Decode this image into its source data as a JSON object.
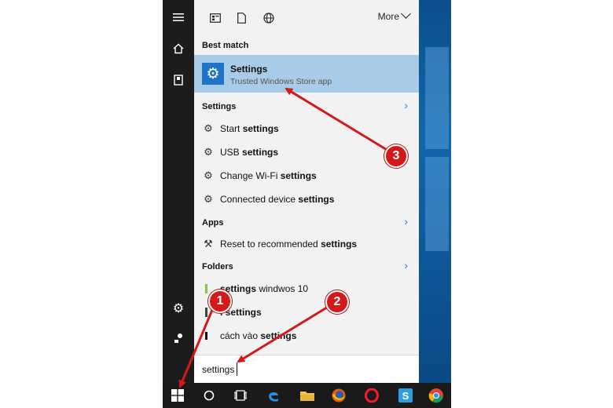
{
  "filters": {
    "more_label": "More"
  },
  "best_match": {
    "header": "Best match",
    "title": "Settings",
    "subtitle": "Trusted Windows Store app"
  },
  "settings_section": {
    "header": "Settings",
    "items": [
      {
        "plain": "Start ",
        "bold": "settings"
      },
      {
        "plain": "USB ",
        "bold": "settings"
      },
      {
        "plain": "Change Wi-Fi ",
        "bold": "settings"
      },
      {
        "plain": "Connected device ",
        "bold": "settings"
      }
    ]
  },
  "apps_section": {
    "header": "Apps",
    "items": [
      {
        "plain": "Reset to recommended ",
        "bold": "settings"
      }
    ]
  },
  "folders_section": {
    "header": "Folders",
    "items": [
      {
        "plain": "",
        "bold": "settings",
        "rest": " windwos 10"
      },
      {
        "plain": "",
        "bold": "i settings",
        "rest": ""
      },
      {
        "plain": "cách vào ",
        "bold": "settings",
        "rest": ""
      }
    ]
  },
  "search": {
    "query": "settings"
  },
  "annotations": {
    "badge_1": "1",
    "badge_2": "2",
    "badge_3": "3"
  },
  "colors": {
    "accent": "#1f74c8",
    "highlight": "#a8cce8",
    "annotation_red": "#d4191b"
  }
}
